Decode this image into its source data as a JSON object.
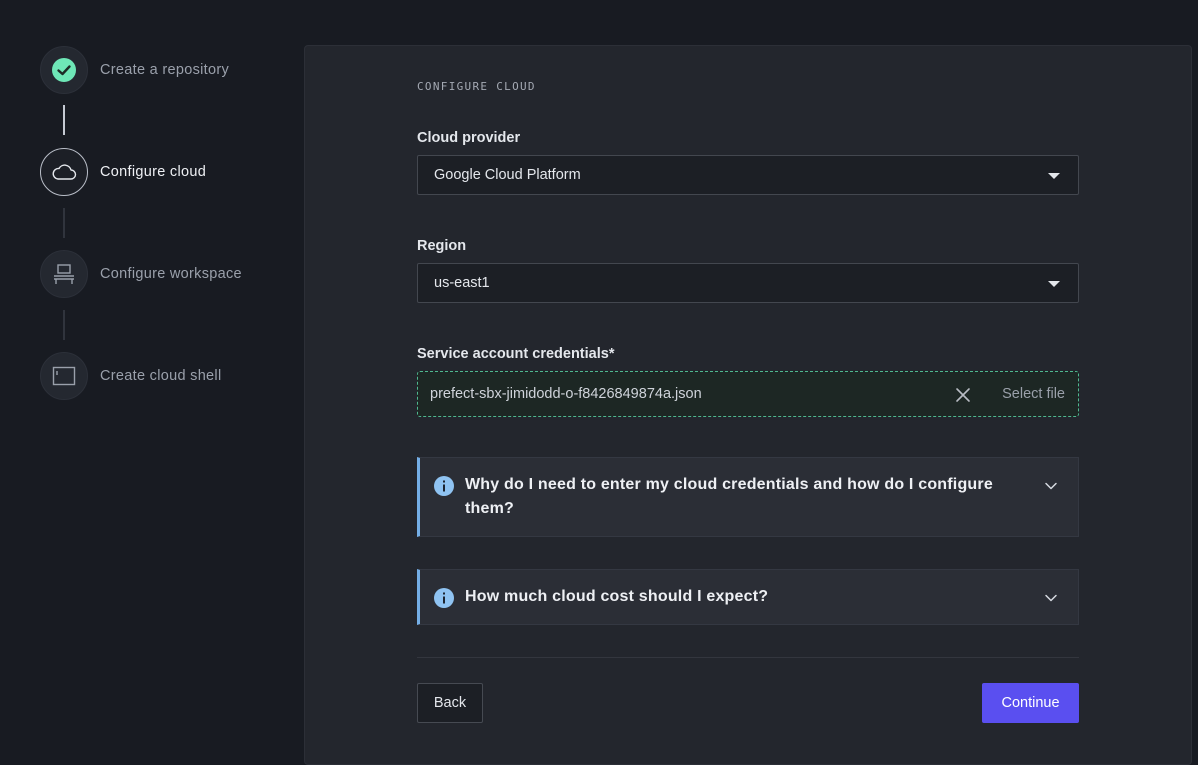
{
  "steps": [
    {
      "label": "Create a repository",
      "state": "done",
      "icon": "check-icon"
    },
    {
      "label": "Configure cloud",
      "state": "active",
      "icon": "cloud-icon"
    },
    {
      "label": "Configure workspace",
      "state": "todo",
      "icon": "workstation-icon"
    },
    {
      "label": "Create cloud shell",
      "state": "todo",
      "icon": "terminal-icon"
    }
  ],
  "section_title": "CONFIGURE CLOUD",
  "cloud_provider": {
    "label": "Cloud provider",
    "value": "Google Cloud Platform"
  },
  "region": {
    "label": "Region",
    "value": "us-east1"
  },
  "credentials": {
    "label": "Service account credentials*",
    "file_name": "prefect-sbx-jimidodd-o-f8426849874a.json",
    "select_file_label": "Select file"
  },
  "faq": [
    {
      "question": "Why do I need to enter my cloud credentials and how do I configure them?"
    },
    {
      "question": "How much cloud cost should I expect?"
    }
  ],
  "actions": {
    "back_label": "Back",
    "continue_label": "Continue"
  },
  "colors": {
    "accent": "#5a4ff0",
    "success": "#6ee7b7",
    "info": "#74aee6",
    "file_border": "#4fb88f"
  }
}
